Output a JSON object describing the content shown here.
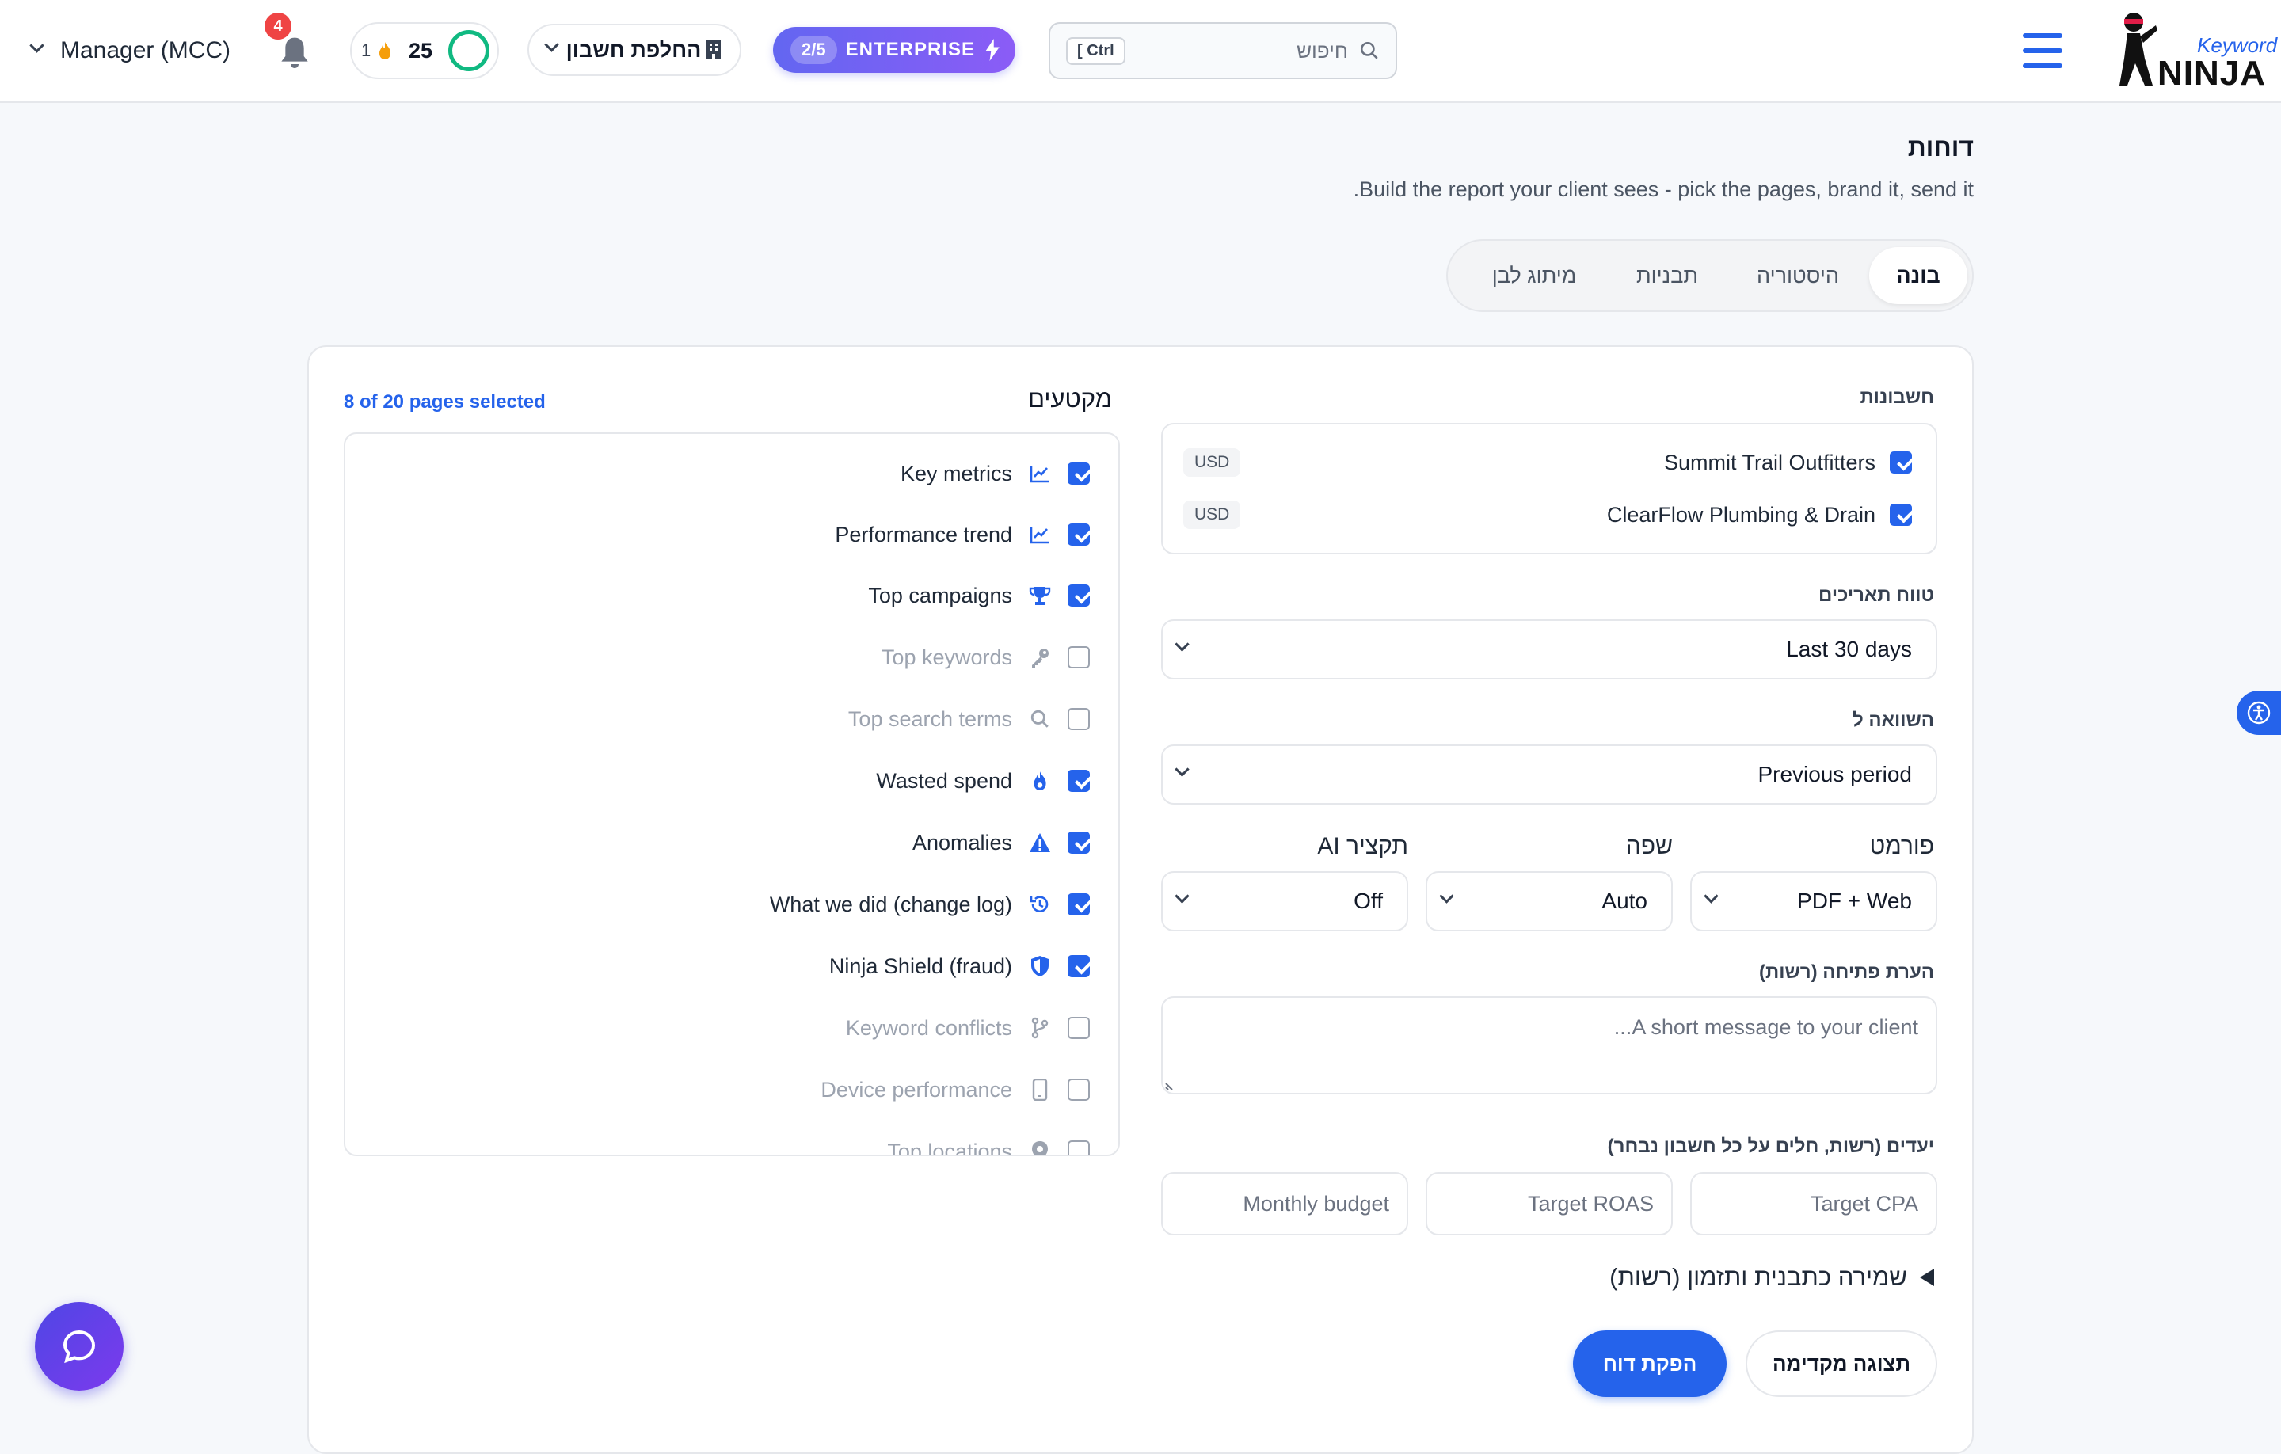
{
  "header": {
    "logo_keyword": "Keyword",
    "logo_ninja": "NINJA",
    "search_placeholder": "חיפוש",
    "search_shortcut": "Ctrl ]",
    "plan_label": "ENTERPRISE",
    "plan_count": "2/5",
    "switch_account": "החלפת חשבון",
    "points": "25",
    "streak": "1",
    "notifications_count": "4",
    "account": "Manager (MCC)"
  },
  "page": {
    "title": "דוחות",
    "subtitle": "Build the report your client sees - pick the pages, brand it, send it."
  },
  "tabs": [
    {
      "label": "בונה",
      "active": true
    },
    {
      "label": "היסטוריה",
      "active": false
    },
    {
      "label": "תבניות",
      "active": false
    },
    {
      "label": "מיתוג לבן",
      "active": false
    }
  ],
  "accounts": {
    "label": "חשבונות",
    "items": [
      {
        "name": "Summit Trail Outfitters",
        "currency": "USD",
        "checked": true
      },
      {
        "name": "ClearFlow Plumbing & Drain",
        "currency": "USD",
        "checked": true
      }
    ]
  },
  "date_range": {
    "label": "טווח תאריכים",
    "value": "Last 30 days"
  },
  "compare": {
    "label": "השוואה ל",
    "value": "Previous period"
  },
  "format": {
    "label": "פורמט",
    "value": "PDF + Web"
  },
  "language": {
    "label": "שפה",
    "value": "Auto"
  },
  "ai_summary": {
    "label": "תקציר AI",
    "value": "Off"
  },
  "intro_note": {
    "label": "הערת פתיחה (רשות)",
    "placeholder": "A short message to your client..."
  },
  "targets": {
    "label": "יעדים (רשות, חלים על כל חשבון נבחר)",
    "cpa_placeholder": "Target CPA",
    "roas_placeholder": "Target ROAS",
    "budget_placeholder": "Monthly budget"
  },
  "save_schedule": "שמירה כתבנית ותזמון (רשות)",
  "buttons": {
    "preview": "תצוגה מקדימה",
    "generate": "הפקת דוח"
  },
  "sections": {
    "title": "מקטעים",
    "count": "8 of 20 pages selected",
    "items": [
      {
        "label": "Key metrics",
        "icon": "chart-line-icon",
        "checked": true
      },
      {
        "label": "Performance trend",
        "icon": "chart-line-icon",
        "checked": true
      },
      {
        "label": "Top campaigns",
        "icon": "trophy-icon",
        "checked": true
      },
      {
        "label": "Top keywords",
        "icon": "key-icon",
        "checked": false
      },
      {
        "label": "Top search terms",
        "icon": "search-icon",
        "checked": false
      },
      {
        "label": "Wasted spend",
        "icon": "fire-icon",
        "checked": true
      },
      {
        "label": "Anomalies",
        "icon": "warning-icon",
        "checked": true
      },
      {
        "label": "What we did (change log)",
        "icon": "history-icon",
        "checked": true
      },
      {
        "label": "Ninja Shield (fraud)",
        "icon": "shield-icon",
        "checked": true
      },
      {
        "label": "Keyword conflicts",
        "icon": "branch-icon",
        "checked": false
      },
      {
        "label": "Device performance",
        "icon": "mobile-icon",
        "checked": false
      },
      {
        "label": "Top locations",
        "icon": "location-pin-icon",
        "checked": false
      }
    ]
  },
  "colors": {
    "primary": "#2563eb",
    "plan_start": "#6366f1",
    "plan_end": "#8b5cf6",
    "badge": "#ef4444"
  }
}
